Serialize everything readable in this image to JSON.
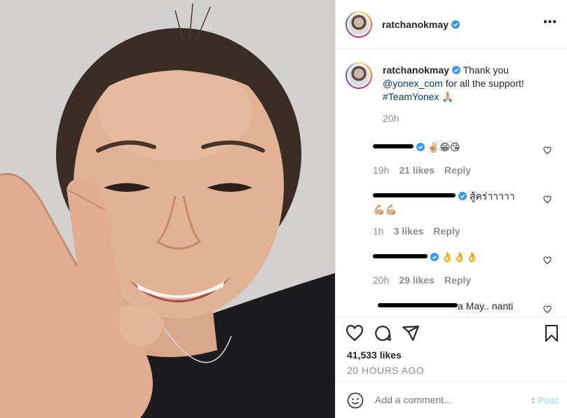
{
  "header": {
    "username": "ratchanokmay",
    "verified_icon": "verified-badge-icon",
    "more_label": "•••"
  },
  "caption": {
    "username": "ratchanokmay",
    "text_before": " Thank you ",
    "mention": "@yonex_com",
    "text_after": " for all the support! ",
    "hashtag": "#TeamYonex",
    "emoji": "🙏🏼",
    "time": "20h"
  },
  "comments": [
    {
      "text": "✌🏼😁😘",
      "time": "19h",
      "likes": "21 likes",
      "reply": "Reply"
    },
    {
      "text": "สู้คร่าาาาา",
      "text2": "💪🏼💪🏼",
      "time": "1h",
      "likes": "3 likes",
      "reply": "Reply"
    },
    {
      "text": "👌👌👌",
      "time": "20h",
      "likes": "29 likes",
      "reply": "Reply"
    },
    {
      "text": "a May.. nanti"
    }
  ],
  "actions": {
    "likes": "41,533 likes",
    "ago": "20 HOURS AGO"
  },
  "add_comment": {
    "placeholder": "Add a comment...",
    "post_label": "Post"
  },
  "colors": {
    "verified": "#3897f0",
    "link": "#00376b",
    "muted": "#8e8e8e",
    "post_disabled": "#b2dffc"
  }
}
